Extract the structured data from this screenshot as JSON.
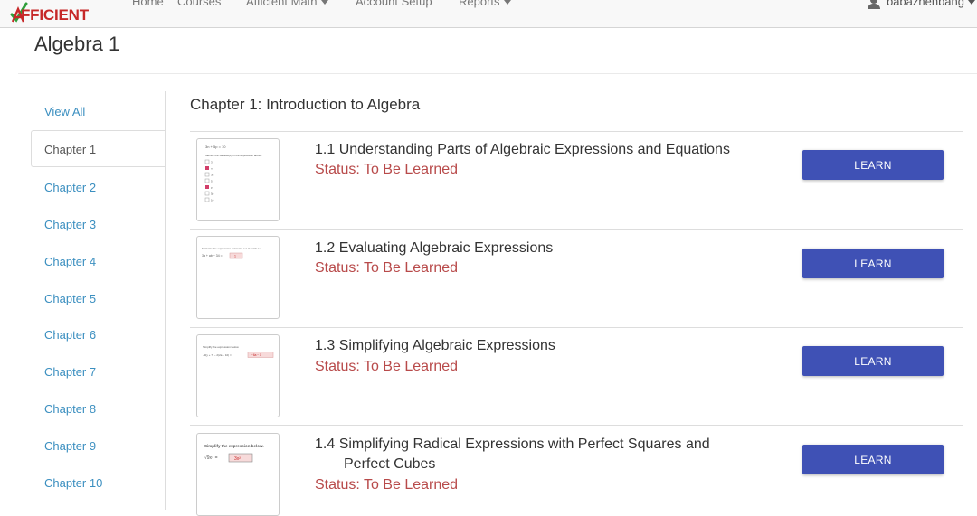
{
  "nav": {
    "logo_text": "FFICIENT",
    "links": [
      "Home",
      "Courses",
      "Afficient Math",
      "Account Setup",
      "Reports"
    ],
    "user": "babazhenbang"
  },
  "page_title": "Algebra 1",
  "sidebar": {
    "items": [
      "View All",
      "Chapter 1",
      "Chapter 2",
      "Chapter 3",
      "Chapter 4",
      "Chapter 5",
      "Chapter 6",
      "Chapter 7",
      "Chapter 8",
      "Chapter 9",
      "Chapter 10"
    ],
    "active": "Chapter 1"
  },
  "chapter_title": "Chapter 1: Introduction to Algebra",
  "lessons": [
    {
      "title": "1.1  Understanding Parts of Algebraic Expressions and Equations",
      "status": "Status: To Be Learned",
      "button": "LEARN"
    },
    {
      "title": "1.2  Evaluating Algebraic Expressions",
      "status": "Status: To Be Learned",
      "button": "LEARN"
    },
    {
      "title": "1.3  Simplifying Algebraic Expressions",
      "status": "Status: To Be Learned",
      "button": "LEARN"
    },
    {
      "title_line1": "1.4  Simplifying Radical Expressions with Perfect Squares and",
      "title_line2": "Perfect Cubes",
      "status": "Status: To Be Learned",
      "button": "LEARN"
    }
  ],
  "thumbnails": {
    "t1": {
      "equation": "3n + 5p = 10",
      "prompt": "Identify the variable(s) in the expression above.",
      "options": [
        "3",
        "n",
        "3n",
        "5",
        "p",
        "5p",
        "10"
      ]
    },
    "t2": {
      "prompt": "Evaluate the expression below for a = 7 and b = 2.",
      "expr": "3a + ab − 34 =",
      "answer": "1"
    },
    "t3": {
      "prompt": "Simplify the expression below.",
      "expr": "−3(y + 7) − 2(2a − 10) =",
      "answer": "−6a − 1"
    },
    "t4": {
      "prompt": "Simplify the expression below.",
      "expr": "√9x⁴ =",
      "answer": "3x²"
    }
  },
  "colors": {
    "accent": "#3f51b5",
    "status": "#b84a4a",
    "link": "#3b8fc0",
    "logo": "#c62828"
  }
}
